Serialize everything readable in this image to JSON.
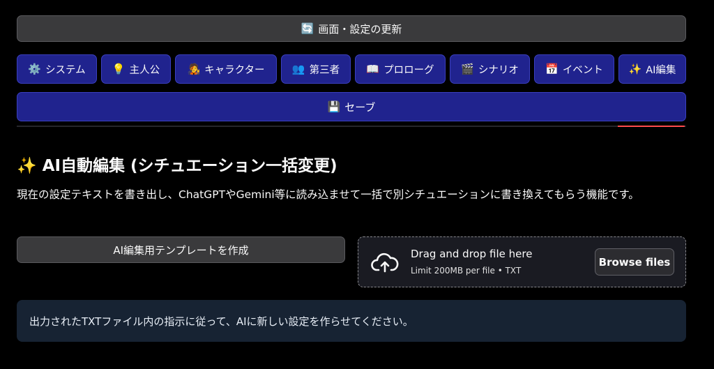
{
  "refresh": {
    "icon": "🔄",
    "label": "画面・設定の更新"
  },
  "nav_tabs": [
    {
      "icon": "⚙️",
      "label": "システム"
    },
    {
      "icon": "💡",
      "label": "主人公"
    },
    {
      "icon": "🧑‍🎤",
      "label": "キャラクター"
    },
    {
      "icon": "👥",
      "label": "第三者"
    },
    {
      "icon": "📖",
      "label": "プロローグ"
    },
    {
      "icon": "🎬",
      "label": "シナリオ"
    },
    {
      "icon": "📅",
      "label": "イベント"
    },
    {
      "icon": "✨",
      "label": "AI編集"
    }
  ],
  "save": {
    "icon": "💾",
    "label": "セーブ"
  },
  "section": {
    "icon": "✨",
    "title": "AI自動編集 (シチュエーション一括変更)",
    "description": "現在の設定テキストを書き出し、ChatGPTやGemini等に読み込ませて一括で別シチュエーションに書き換えてもらう機能です。"
  },
  "template_button": {
    "label": "AI編集用テンプレートを作成"
  },
  "uploader": {
    "drag_text": "Drag and drop file here",
    "limit_text": "Limit 200MB per file • TXT",
    "browse_label": "Browse files"
  },
  "info": {
    "text": "出力されたTXTファイル内の指示に従って、AIに新しい設定を作らせてください。"
  },
  "colors": {
    "nav_bg": "#20238e",
    "active_tab_underline": "#ff4b4b",
    "info_bg": "#172333"
  }
}
